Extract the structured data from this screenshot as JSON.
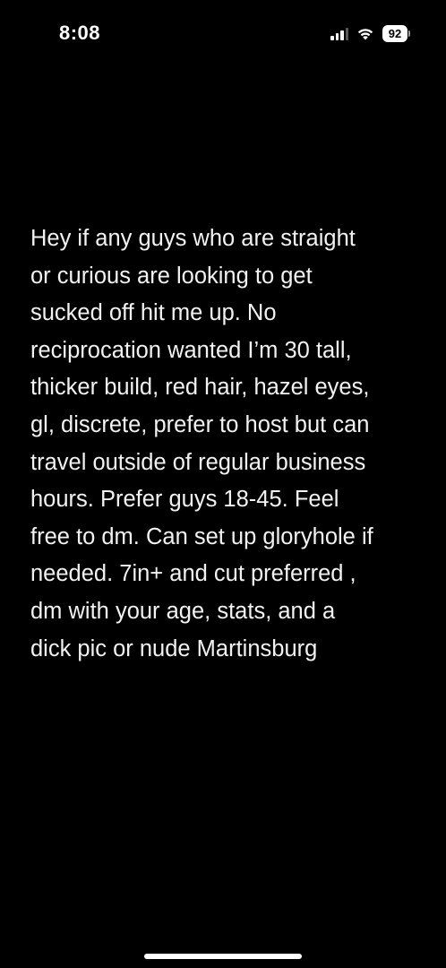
{
  "status_bar": {
    "time": "8:08",
    "battery_level": "92",
    "signal_icon": "cellular-signal-icon",
    "wifi_icon": "wifi-icon",
    "battery_icon": "battery-icon"
  },
  "post": {
    "text": "Hey if any guys who are straight\nor curious are looking to get\nsucked off hit me up. No\nreciprocation wanted I’m 30 tall,\nthicker build, red hair, hazel eyes,\ngl, discrete,  prefer to host but can\ntravel outside of regular business\nhours.  Prefer guys 18-45.  Feel\nfree to dm. Can set up gloryhole if\nneeded.  7in+ and cut preferred ,\ndm with your age, stats, and a\ndick pic or nude Martinsburg"
  },
  "colors": {
    "background": "#000000",
    "text": "#f2f2f2"
  }
}
